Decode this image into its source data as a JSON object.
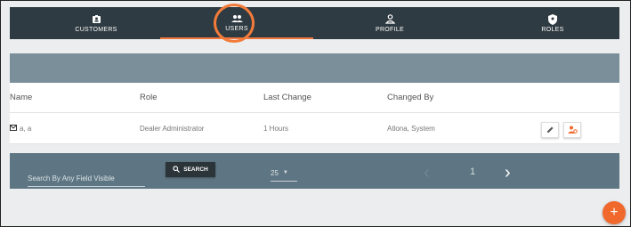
{
  "nav": {
    "tabs": [
      {
        "label": "CUSTOMERS",
        "icon": "id-card-icon"
      },
      {
        "label": "USERS",
        "icon": "users-icon",
        "active": true
      },
      {
        "label": "PROFILE",
        "icon": "person-icon"
      },
      {
        "label": "ROLES",
        "icon": "shield-icon"
      }
    ]
  },
  "table": {
    "headers": [
      "Name",
      "Role",
      "Last Change",
      "Changed By"
    ],
    "rows": [
      {
        "name": "a, a",
        "role": "Dealer Administrator",
        "last_change": "1 Hours",
        "changed_by": "Atlona, System"
      }
    ]
  },
  "footer": {
    "search_placeholder": "Search By Any Field Visible",
    "search_button": "SEARCH",
    "per_page": "25",
    "page": "1"
  },
  "fab_label": "+",
  "colors": {
    "accent": "#f0682c",
    "nav_bg": "#2f3b42",
    "band": "#7a8f99",
    "footer": "#5e7683"
  }
}
